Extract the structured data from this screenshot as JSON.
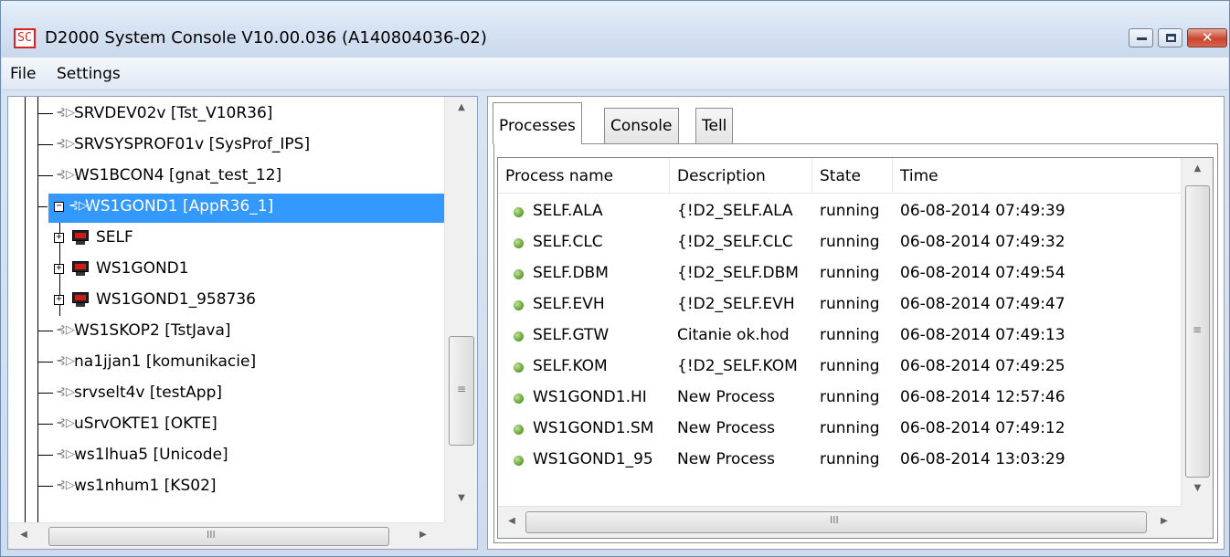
{
  "window": {
    "icon_text": "SC",
    "title": "D2000 System Console V10.00.036 (A140804036-02)",
    "controls": {
      "minimize": "minimize",
      "maximize": "maximize",
      "close": "✕"
    }
  },
  "menu": {
    "file": "File",
    "settings": "Settings"
  },
  "tree": {
    "items": [
      {
        "label": "SRVDEV02v [Tst_V10R36]",
        "kind": "connection"
      },
      {
        "label": "SRVSYSPROF01v [SysProf_IPS]",
        "kind": "connection"
      },
      {
        "label": "WS1BCON4 [gnat_test_12]",
        "kind": "connection"
      },
      {
        "label": "WS1GOND1 [AppR36_1]",
        "kind": "connection",
        "selected": true,
        "expanded": true
      },
      {
        "label": "SELF",
        "kind": "process-host"
      },
      {
        "label": "WS1GOND1",
        "kind": "process-host"
      },
      {
        "label": "WS1GOND1_958736",
        "kind": "process-host"
      },
      {
        "label": "WS1SKOP2 [TstJava]",
        "kind": "connection"
      },
      {
        "label": "na1jjan1 [komunikacie]",
        "kind": "connection"
      },
      {
        "label": "srvselt4v [testApp]",
        "kind": "connection"
      },
      {
        "label": "uSrvOKTE1 [OKTE]",
        "kind": "connection"
      },
      {
        "label": "ws1lhua5 [Unicode]",
        "kind": "connection"
      },
      {
        "label": "ws1nhum1 [KS02]",
        "kind": "connection"
      }
    ],
    "scroll_grip": "≡",
    "hscroll_grip": "III"
  },
  "tabs": [
    {
      "label": "Processes",
      "active": true
    },
    {
      "label": "Console",
      "active": false
    },
    {
      "label": "Tell",
      "active": false
    }
  ],
  "process_table": {
    "columns": [
      "Process name",
      "Description",
      "State",
      "Time"
    ],
    "rows": [
      {
        "name": "SELF.ALA",
        "description": "{!D2_SELF.ALA",
        "state": "running",
        "time": "06-08-2014 07:49:39"
      },
      {
        "name": "SELF.CLC",
        "description": "{!D2_SELF.CLC",
        "state": "running",
        "time": "06-08-2014 07:49:32"
      },
      {
        "name": "SELF.DBM",
        "description": "{!D2_SELF.DBM",
        "state": "running",
        "time": "06-08-2014 07:49:54"
      },
      {
        "name": "SELF.EVH",
        "description": "{!D2_SELF.EVH",
        "state": "running",
        "time": "06-08-2014 07:49:47"
      },
      {
        "name": "SELF.GTW",
        "description": "Citanie ok.hod",
        "state": "running",
        "time": "06-08-2014 07:49:13"
      },
      {
        "name": "SELF.KOM",
        "description": "{!D2_SELF.KOM",
        "state": "running",
        "time": "06-08-2014 07:49:25"
      },
      {
        "name": "WS1GOND1.HI",
        "description": "New Process",
        "state": "running",
        "time": "06-08-2014 12:57:46"
      },
      {
        "name": "WS1GOND1.SM",
        "description": "New Process",
        "state": "running",
        "time": "06-08-2014 07:49:12"
      },
      {
        "name": "WS1GOND1_95",
        "description": "New Process",
        "state": "running",
        "time": "06-08-2014 13:03:29"
      }
    ],
    "status_color": "#6aa53a",
    "scroll_grip": "≡",
    "hscroll_grip": "III"
  },
  "colors": {
    "selection": "#3399ff",
    "close_button": "#c8452d"
  }
}
